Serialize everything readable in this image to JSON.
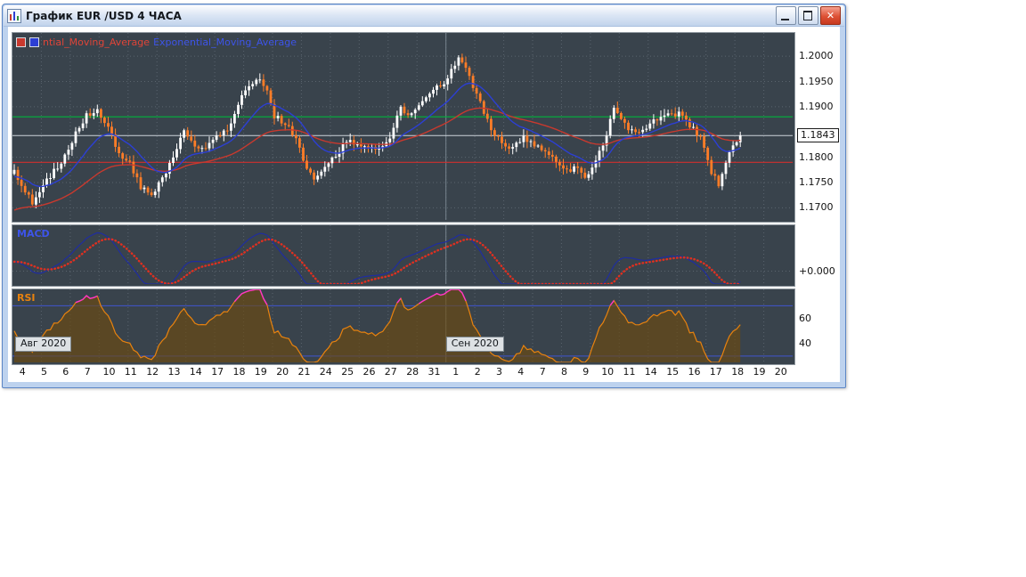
{
  "window": {
    "title": "График EUR /USD 4 ЧАСА",
    "controls": [
      {
        "name": "minimize"
      },
      {
        "name": "maximize"
      },
      {
        "name": "close"
      }
    ]
  },
  "icons": {
    "titlebar_app": "candlestick-chart",
    "minimize": "window-minimize",
    "maximize": "window-maximize",
    "close": "window-close"
  },
  "chart_data": {
    "type": "candlestick",
    "symbol": "EUR/USD",
    "timeframe": "4 часа",
    "legend": {
      "red": "ntial_Moving_Average",
      "blue": "Exponential_Moving_Average"
    },
    "price_axis": {
      "min": 1.1676,
      "max": 1.2046,
      "ticks": [
        {
          "label": "1.2000",
          "value": 1.2
        },
        {
          "label": "1.1950",
          "value": 1.195
        },
        {
          "label": "1.1900",
          "value": 1.19
        },
        {
          "label": "1.1800",
          "value": 1.18
        },
        {
          "label": "1.1750",
          "value": 1.175
        },
        {
          "label": "1.1700",
          "value": 1.17
        }
      ],
      "current_price": 1.1843,
      "current_price_label": "1.1843"
    },
    "levels": {
      "green_line": 1.188,
      "red_line": 1.179
    },
    "x_axis": {
      "slots_per_day": 6,
      "month_separator_day_index": 20,
      "day_labels": [
        "4",
        "5",
        "6",
        "7",
        "10",
        "11",
        "12",
        "13",
        "14",
        "17",
        "18",
        "19",
        "20",
        "21",
        "24",
        "25",
        "26",
        "27",
        "28",
        "31",
        "1",
        "2",
        "3",
        "4",
        "7",
        "8",
        "9",
        "10",
        "11",
        "14",
        "15",
        "16",
        "17",
        "18",
        "19",
        "20"
      ]
    },
    "month_labels": [
      {
        "text": "Авг 2020",
        "day_index": 0
      },
      {
        "text": "Сен 2020",
        "day_index": 20
      }
    ],
    "anchors": [
      [
        0,
        1.1775
      ],
      [
        2,
        1.1742
      ],
      [
        5,
        1.1712
      ],
      [
        8,
        1.1748
      ],
      [
        11,
        1.1772
      ],
      [
        14,
        1.1802
      ],
      [
        17,
        1.1846
      ],
      [
        20,
        1.1882
      ],
      [
        23,
        1.1896
      ],
      [
        26,
        1.1858
      ],
      [
        29,
        1.1808
      ],
      [
        32,
        1.1788
      ],
      [
        35,
        1.1742
      ],
      [
        38,
        1.1728
      ],
      [
        41,
        1.1756
      ],
      [
        44,
        1.1802
      ],
      [
        47,
        1.185
      ],
      [
        50,
        1.1822
      ],
      [
        53,
        1.1816
      ],
      [
        56,
        1.1838
      ],
      [
        59,
        1.1854
      ],
      [
        62,
        1.1906
      ],
      [
        65,
        1.1942
      ],
      [
        68,
        1.1954
      ],
      [
        70,
        1.1932
      ],
      [
        72,
        1.1882
      ],
      [
        75,
        1.1866
      ],
      [
        78,
        1.184
      ],
      [
        81,
        1.1772
      ],
      [
        83,
        1.1758
      ],
      [
        86,
        1.1786
      ],
      [
        89,
        1.1802
      ],
      [
        92,
        1.1832
      ],
      [
        95,
        1.1828
      ],
      [
        98,
        1.1822
      ],
      [
        101,
        1.1818
      ],
      [
        104,
        1.184
      ],
      [
        107,
        1.1896
      ],
      [
        110,
        1.1882
      ],
      [
        113,
        1.1906
      ],
      [
        116,
        1.1936
      ],
      [
        119,
        1.1942
      ],
      [
        121,
        1.1972
      ],
      [
        123,
        1.1996
      ],
      [
        125,
        1.1976
      ],
      [
        127,
        1.1942
      ],
      [
        129,
        1.1908
      ],
      [
        132,
        1.1854
      ],
      [
        135,
        1.1828
      ],
      [
        138,
        1.1818
      ],
      [
        141,
        1.1842
      ],
      [
        144,
        1.1824
      ],
      [
        147,
        1.1812
      ],
      [
        150,
        1.1792
      ],
      [
        153,
        1.1772
      ],
      [
        156,
        1.1784
      ],
      [
        158,
        1.1756
      ],
      [
        160,
        1.178
      ],
      [
        163,
        1.1822
      ],
      [
        166,
        1.1898
      ],
      [
        169,
        1.1864
      ],
      [
        172,
        1.1846
      ],
      [
        175,
        1.1862
      ],
      [
        178,
        1.1874
      ],
      [
        181,
        1.1882
      ],
      [
        184,
        1.1886
      ],
      [
        187,
        1.1864
      ],
      [
        190,
        1.1838
      ],
      [
        193,
        1.1768
      ],
      [
        195,
        1.1748
      ],
      [
        197,
        1.179
      ],
      [
        199,
        1.1822
      ],
      [
        201,
        1.1843
      ]
    ],
    "indicators": {
      "ema_fast": {
        "period": 16,
        "seed": 1.176
      },
      "ema_slow": {
        "period": 48,
        "seed": 1.1692
      },
      "macd": {
        "label": "MACD",
        "fast": 12,
        "slow": 26,
        "signal": 9,
        "zero_label": "+0.000",
        "range": [
          -0.0013,
          0.0046
        ]
      },
      "rsi": {
        "label": "RSI",
        "period": 14,
        "levels": [
          70,
          30
        ],
        "range": [
          25,
          83
        ],
        "ticks": [
          {
            "label": "60",
            "value": 60
          },
          {
            "label": "40",
            "value": 40
          }
        ]
      }
    },
    "colors": {
      "panel_bg": "#39434c",
      "panel_border": "#8e979e",
      "grid": "#5a646e",
      "separator": "#77838e",
      "bull": "#ffffff",
      "bear": "#ff7d27",
      "ema_fast": "#2c3fd4",
      "ema_slow": "#c8392e",
      "green_level": "#00b53c",
      "red_level": "#cf2f2f",
      "current_price_line": "#cdd3d9",
      "macd_line": "#1f2da0",
      "macd_signal": "#e03020",
      "rsi_line": "#e8820e",
      "rsi_fill": "#6b4a10",
      "rsi_hot": "#ff35c8",
      "rsi_level": "#4055cf"
    }
  }
}
